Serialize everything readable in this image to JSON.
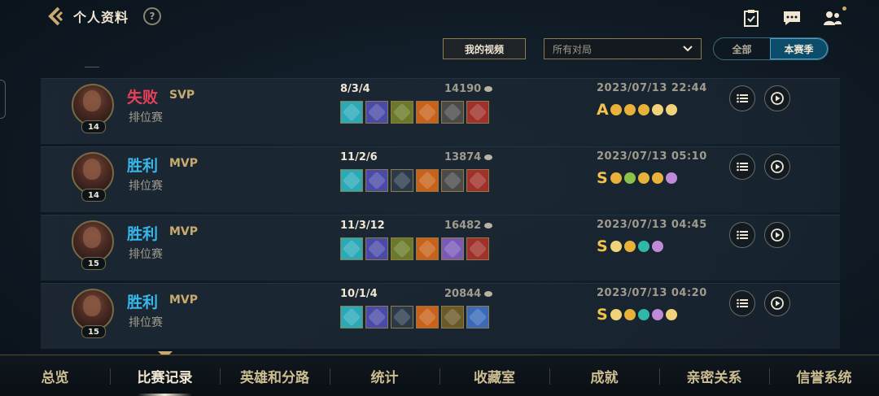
{
  "header": {
    "title": "个人资料",
    "help": "?"
  },
  "toolbar": {
    "video_label": "我的视频",
    "filter_value": "所有对局",
    "season_tabs": [
      "全部",
      "本赛季"
    ],
    "active_season_tab": "本赛季"
  },
  "matches": [
    {
      "level": "14",
      "result": "失败",
      "result_type": "lose",
      "grade": "SVP",
      "mode": "排位赛",
      "kda": "8/3/4",
      "gold": "14190",
      "date": "2023/07/13 22:44",
      "rank_letter": "A",
      "items": [
        "#2aa9b8",
        "#4a4aa8",
        "#6a7a2a",
        "#c8621a",
        "#4a4a4a",
        "#a0302a"
      ],
      "badges": [
        "",
        "",
        "",
        "y",
        "y"
      ]
    },
    {
      "level": "14",
      "result": "胜利",
      "result_type": "win",
      "grade": "MVP",
      "mode": "排位赛",
      "kda": "11/2/6",
      "gold": "13874",
      "date": "2023/07/13 05:10",
      "rank_letter": "S",
      "items": [
        "#2aa9b8",
        "#4a4aa8",
        "#2a3a4a",
        "#c8621a",
        "#4a4a4a",
        "#a0302a"
      ],
      "badges": [
        "",
        "g",
        "",
        "",
        "p"
      ]
    },
    {
      "level": "15",
      "result": "胜利",
      "result_type": "win",
      "grade": "MVP",
      "mode": "排位赛",
      "kda": "11/3/12",
      "gold": "16482",
      "date": "2023/07/13 04:45",
      "rank_letter": "S",
      "items": [
        "#2aa9b8",
        "#4a4aa8",
        "#6a7a2a",
        "#c8621a",
        "#7a5ab8",
        "#a0302a"
      ],
      "badges": [
        "y",
        "",
        "c",
        "p"
      ]
    },
    {
      "level": "15",
      "result": "胜利",
      "result_type": "win",
      "grade": "MVP",
      "mode": "排位赛",
      "kda": "10/1/4",
      "gold": "20844",
      "date": "2023/07/13 04:20",
      "rank_letter": "S",
      "items": [
        "#2aa9b8",
        "#4a4aa8",
        "#2a3a4a",
        "#c8621a",
        "#6a5a2a",
        "#3a6ab8"
      ],
      "badges": [
        "y",
        "",
        "c",
        "p",
        "y"
      ]
    }
  ],
  "nav": {
    "tabs": [
      "总览",
      "比赛记录",
      "英雄和分路",
      "统计",
      "收藏室",
      "成就",
      "亲密关系",
      "信誉系统"
    ],
    "active": "比赛记录"
  }
}
